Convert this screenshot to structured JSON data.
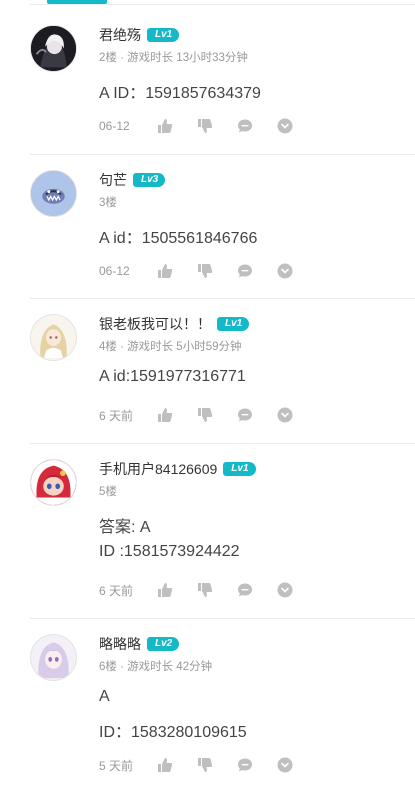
{
  "colors": {
    "accent": "#14b9c8",
    "meta": "#999999",
    "icon": "#bfbfbf"
  },
  "comments": [
    {
      "username": "君绝殇",
      "level": "Lv1",
      "meta": "2楼 · 游戏时长 13小时33分钟",
      "lines": [
        "A  ID：1591857634379"
      ],
      "time": "06-12",
      "avatar_icon": "dark-character-avatar"
    },
    {
      "username": "句芒",
      "level": "Lv3",
      "meta": "3楼",
      "lines": [
        "A id：1505561846766"
      ],
      "time": "06-12",
      "avatar_icon": "blue-creature-avatar"
    },
    {
      "username": "银老板我可以！！",
      "level": "Lv1",
      "meta": "4楼 · 游戏时长 5小时59分钟",
      "lines": [
        "A id:1591977316771"
      ],
      "time": "6 天前",
      "avatar_icon": "blonde-character-avatar"
    },
    {
      "username": "手机用户84126609",
      "level": "Lv1",
      "meta": "5楼",
      "lines": [
        "答案: A",
        "ID :1581573924422"
      ],
      "time": "6 天前",
      "avatar_icon": "red-character-avatar"
    },
    {
      "username": "略略略",
      "level": "Lv2",
      "meta": "6楼 · 游戏时长 42分钟",
      "lines": [
        "A",
        "ID：1583280109615"
      ],
      "time": "5 天前",
      "avatar_icon": "lavender-character-avatar"
    }
  ]
}
